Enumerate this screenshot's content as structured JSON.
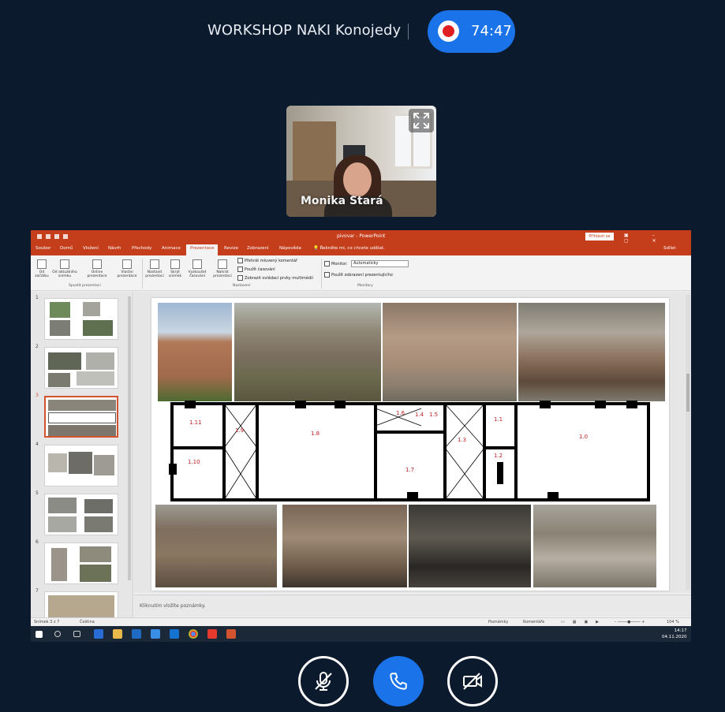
{
  "meeting": {
    "title": "WORKSHOP NAKI Konojedy",
    "recording_time": "74:47"
  },
  "participant": {
    "name": "Monika Stará"
  },
  "powerpoint": {
    "window_title": "pivovar - PowerPoint",
    "sign_in": "Přihlásit se",
    "tabs": [
      "Soubor",
      "Domů",
      "Vložení",
      "Návrh",
      "Přechody",
      "Animace",
      "Prezentace",
      "Revize",
      "Zobrazení",
      "Nápověda"
    ],
    "active_tab": "Prezentace",
    "tell_me": "Řekněte mi, co chcete udělat.",
    "share": "Sdílet",
    "ribbon": {
      "from_start": "Od začátku",
      "from_current": "Od aktuálního snímku",
      "present_online": "Online prezentace",
      "custom_show": "Vlastní prezentace",
      "group_start": "Spustit prezentaci",
      "setup_show": "Nastavit prezentaci",
      "hide_slide": "Skrýt snímek",
      "rehearse": "Vyzkoušet časování",
      "record": "Nahrát prezentaci",
      "check_narration": "Přehrát mluvený komentář",
      "check_timings": "Použít časování",
      "check_media": "Zobrazit ovládací prvky multimédií",
      "group_setup": "Nastavení",
      "monitor_label": "Monitor:",
      "monitor_value": "Automaticky",
      "presenter_view": "Použít zobrazení prezentujícího",
      "group_monitors": "Monitory"
    },
    "slide_numbers": [
      "1",
      "2",
      "3",
      "4",
      "5",
      "6",
      "7"
    ],
    "active_slide": "3",
    "notes_placeholder": "Kliknutím vložíte poznámky.",
    "status": {
      "slide_of": "Snímek 3 z 7",
      "language": "Čeština",
      "notes": "Poznámky",
      "comments": "Komentáře",
      "zoom": "104 %"
    },
    "clock_time": "14:17",
    "clock_date": "04.11.2020",
    "plan_labels": [
      "1.11",
      "1.10",
      "1.9",
      "1.8",
      "1.7",
      "1.6",
      "1.4",
      "1.5",
      "1.3",
      "1.1",
      "1.2",
      "1.0"
    ]
  },
  "colors": {
    "background": "#0c1a2e",
    "accent_blue": "#1a73e8",
    "record_red": "#e02020",
    "powerpoint_red": "#c43e1c"
  },
  "icons": {
    "expand": "expand-icon",
    "mic_off": "mic-off-icon",
    "phone": "phone-icon",
    "camera_off": "camera-off-icon"
  }
}
